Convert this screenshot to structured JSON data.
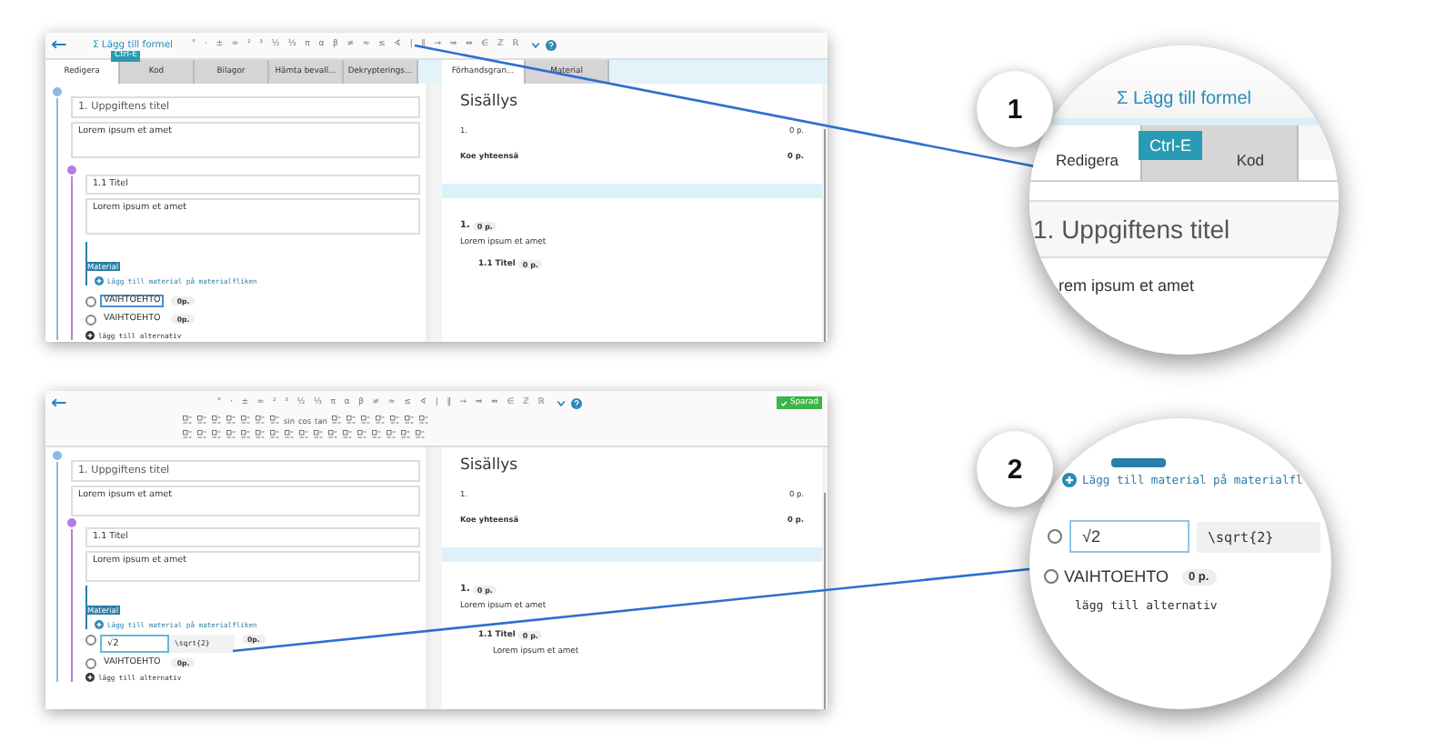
{
  "panels": [
    {
      "formula_button": "Σ Lägg till formel",
      "tooltip": "Ctrl-E",
      "symbols": [
        "°",
        "·",
        "±",
        "∞",
        "²",
        "³",
        "½",
        "⅓",
        "π",
        "α",
        "β",
        "≠",
        "≈",
        "≤",
        "∢",
        "|",
        "‖",
        "→",
        "⇒",
        "⇔",
        "∈",
        "ℤ",
        "ℝ"
      ],
      "tabs_left": [
        {
          "label": "Redigera",
          "selected": true
        },
        {
          "label": "Kod",
          "selected": false
        },
        {
          "label": "Bilagor",
          "selected": false
        },
        {
          "label": "Hämta bevall...",
          "selected": false
        },
        {
          "label": "Dekrypterings...",
          "selected": false
        }
      ],
      "tabs_right": [
        {
          "label": "Förhandsgran...",
          "selected": true
        },
        {
          "label": "Material",
          "selected": false
        }
      ],
      "section_title": "1. Uppgiftens titel",
      "section_text": "Lorem ipsum et amet",
      "sub_title": "1.1 Titel",
      "sub_text": "Lorem ipsum et amet",
      "material_tag": "Material",
      "material_link": "Lägg till material på materialfliken",
      "choices": [
        {
          "kind": "text",
          "label": "VAIHTOEHTO",
          "points": "0p.",
          "checked": false,
          "focused": true
        },
        {
          "kind": "text",
          "label": "VAIHTOEHTO",
          "points": "0p.",
          "checked": false,
          "focused": false
        }
      ],
      "add_choice": "lägg till alternativ",
      "preview": {
        "title": "Sisällys",
        "rows": [
          {
            "label": "1.",
            "points": "0 p.",
            "bold": false
          },
          {
            "label": "Koe yhteensä",
            "points": "0 p.",
            "bold": true
          }
        ],
        "q_number": "1.",
        "q_points": "0 p.",
        "q_text": "Lorem ipsum et amet",
        "sub_title": "1.1 Titel",
        "sub_points": "0 p."
      }
    },
    {
      "saved": "Sparad",
      "symbols": [
        "°",
        "·",
        "±",
        "∞",
        "²",
        "³",
        "½",
        "⅓",
        "π",
        "α",
        "β",
        "≠",
        "≈",
        "≤",
        "∢",
        "|",
        "‖",
        "→",
        "⇒",
        "⇔",
        "∈",
        "ℤ",
        "ℝ"
      ],
      "formula_rows": [
        [
          {
            "kind": "icon"
          },
          {
            "kind": "icon"
          },
          {
            "kind": "icon"
          },
          {
            "kind": "icon"
          },
          {
            "kind": "icon"
          },
          {
            "kind": "icon"
          },
          {
            "kind": "icon"
          },
          {
            "kind": "text",
            "label": "sin"
          },
          {
            "kind": "text",
            "label": "cos"
          },
          {
            "kind": "text",
            "label": "tan"
          },
          {
            "kind": "icon"
          },
          {
            "kind": "icon"
          },
          {
            "kind": "icon"
          },
          {
            "kind": "icon"
          },
          {
            "kind": "icon"
          },
          {
            "kind": "icon"
          },
          {
            "kind": "icon"
          }
        ],
        [
          {
            "kind": "icon"
          },
          {
            "kind": "icon"
          },
          {
            "kind": "icon"
          },
          {
            "kind": "icon"
          },
          {
            "kind": "icon"
          },
          {
            "kind": "icon"
          },
          {
            "kind": "icon"
          },
          {
            "kind": "icon"
          },
          {
            "kind": "icon"
          },
          {
            "kind": "icon"
          },
          {
            "kind": "icon"
          },
          {
            "kind": "icon"
          },
          {
            "kind": "icon"
          },
          {
            "kind": "icon"
          },
          {
            "kind": "icon"
          },
          {
            "kind": "icon"
          },
          {
            "kind": "icon"
          }
        ]
      ],
      "section_title": "1. Uppgiftens titel",
      "section_text": "Lorem ipsum et amet",
      "sub_title": "1.1 Titel",
      "sub_text": "Lorem ipsum et amet",
      "material_tag": "Material",
      "material_link": "Lägg till material på materialfliken",
      "choices": [
        {
          "kind": "formula",
          "formula": "√2",
          "latex": "\\sqrt{2}",
          "points": "0p.",
          "checked": false,
          "focused": true
        },
        {
          "kind": "text",
          "label": "VAIHTOEHTO",
          "points": "0p.",
          "checked": false,
          "focused": false
        }
      ],
      "add_choice": "lägg till alternativ",
      "preview": {
        "title": "Sisällys",
        "rows": [
          {
            "label": "1.",
            "points": "0 p.",
            "bold": false
          },
          {
            "label": "Koe yhteensä",
            "points": "0 p.",
            "bold": true
          }
        ],
        "q_number": "1.",
        "q_points": "0 p.",
        "q_text": "Lorem ipsum et amet",
        "sub_title": "1.1 Titel",
        "sub_points": "0 p.",
        "sub_text": "Lorem ipsum et amet"
      }
    }
  ],
  "magnifiers": [
    {
      "step": "1",
      "formula_button": "Σ Lägg till formel",
      "tooltip": "Ctrl-E",
      "tabs": [
        {
          "label": "Redigera",
          "selected": true
        },
        {
          "label": "Kod",
          "selected": false
        }
      ],
      "title": "1. Uppgiftens titel",
      "text": "rem ipsum et amet"
    },
    {
      "step": "2",
      "material_link": "Lägg till material på materialfl",
      "formula": "√2",
      "latex": "\\sqrt{2}",
      "formula_checked": false,
      "choice": "VAIHTOEHTO",
      "choice_checked": false,
      "points": "0 p.",
      "add_choice": "lägg till alternativ"
    }
  ]
}
